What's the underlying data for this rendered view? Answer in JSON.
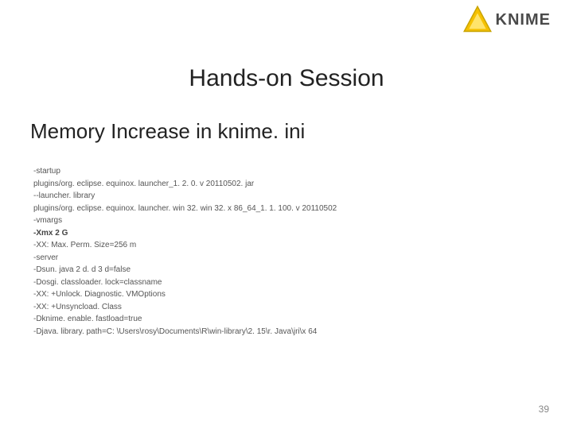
{
  "logo": {
    "text": "KNIME"
  },
  "slide": {
    "title": "Hands-on Session",
    "subtitle": "Memory Increase in knime. ini",
    "page_number": "39"
  },
  "ini": {
    "lines": [
      "-startup",
      "plugins/org. eclipse. equinox. launcher_1. 2. 0. v 20110502. jar",
      "--launcher. library",
      "plugins/org. eclipse. equinox. launcher. win 32. win 32. x 86_64_1. 1. 100. v 20110502",
      "-vmargs"
    ],
    "highlight": "-Xmx 2 G",
    "lines_after": [
      "-XX: Max. Perm. Size=256 m",
      "-server",
      "-Dsun. java 2 d. d 3 d=false",
      "-Dosgi. classloader. lock=classname",
      "-XX: +Unlock. Diagnostic. VMOptions",
      "-XX: +Unsyncload. Class",
      "-Dknime. enable. fastload=true",
      "-Djava. library. path=C: \\Users\\rosy\\Documents\\R\\win-library\\2. 15\\r. Java\\jri\\x 64"
    ]
  }
}
